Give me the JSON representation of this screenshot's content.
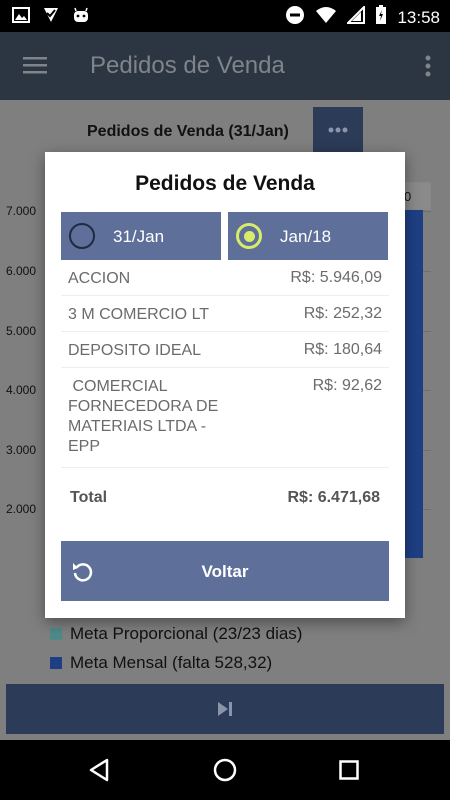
{
  "status_bar": {
    "time": "13:58"
  },
  "app_bar": {
    "title": "Pedidos de Venda"
  },
  "chart": {
    "title": "Pedidos de Venda (31/Jan)",
    "y_ticks": [
      "7.000",
      "6.000",
      "5.000",
      "4.000",
      "3.000",
      "2.000"
    ],
    "bar_header_label": "0",
    "legend": [
      {
        "label": "Meta Proporcional (23/23 dias)",
        "color": "#4f8a8b"
      },
      {
        "label": "Meta Mensal (falta 528,32)",
        "color": "#1f3f85"
      }
    ]
  },
  "dialog": {
    "title": "Pedidos de Venda",
    "tabs": [
      {
        "label": "31/Jan",
        "selected": false
      },
      {
        "label": "Jan/18",
        "selected": true
      }
    ],
    "rows": [
      {
        "name": "ACCION",
        "value": "R$: 5.946,09"
      },
      {
        "name": "3 M COMERCIO LT",
        "value": "R$: 252,32"
      },
      {
        "name": "DEPOSITO IDEAL",
        "value": "R$: 180,64"
      },
      {
        "name": " COMERCIAL FORNECEDORA DE MATERIAIS LTDA - EPP",
        "value": "R$: 92,62"
      }
    ],
    "total_label": "Total",
    "total_value": "R$: 6.471,68",
    "back_label": "Voltar"
  },
  "colors": {
    "accent": "#5e7099",
    "radio_selected": "#d8ec6a",
    "app_bar": "#2c3642"
  }
}
